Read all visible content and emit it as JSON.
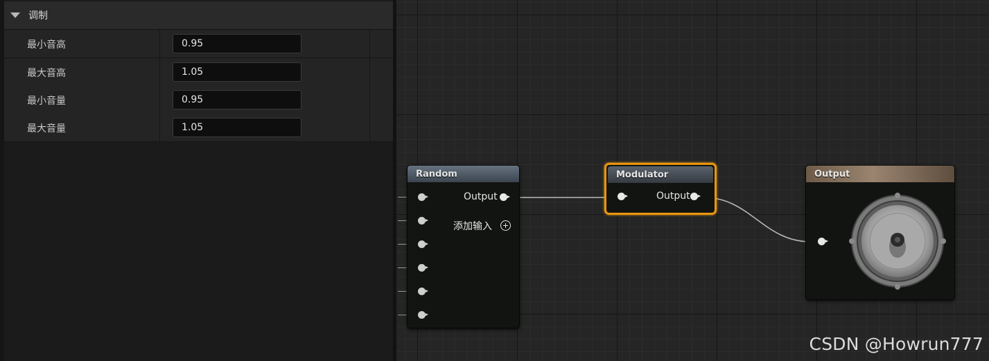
{
  "details": {
    "section_title": "调制",
    "rows": [
      {
        "label": "最小音高",
        "value": "0.95"
      },
      {
        "label": "最大音高",
        "value": "1.05"
      },
      {
        "label": "最小音量",
        "value": "0.95"
      },
      {
        "label": "最大音量",
        "value": "1.05"
      }
    ]
  },
  "graph": {
    "nodes": {
      "random": {
        "title": "Random",
        "output_label": "Output",
        "add_input_label": "添加输入"
      },
      "modulator": {
        "title": "Modulator",
        "output_label": "Output"
      },
      "output": {
        "title": "Output",
        "icon": "speaker-icon"
      }
    }
  },
  "watermark": "CSDN @Howrun777",
  "colors": {
    "selection_orange": "#e8960f",
    "random_header": "#4e5a66",
    "modulator_header": "#454c56",
    "output_header": "#6b5a48"
  }
}
